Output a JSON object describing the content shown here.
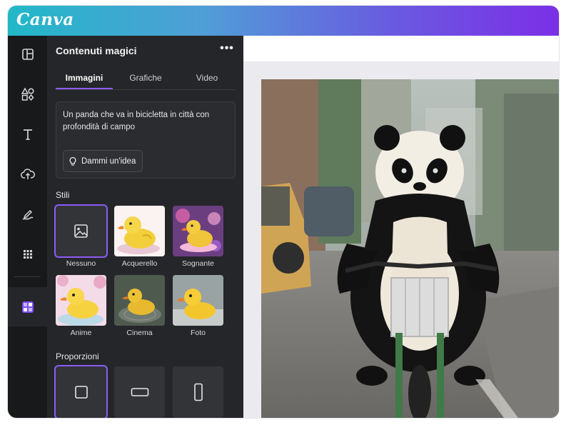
{
  "app": {
    "logo_text": "Canva"
  },
  "rail": {
    "items": [
      {
        "icon": "layout-icon"
      },
      {
        "icon": "elements-icon"
      },
      {
        "icon": "text-icon"
      },
      {
        "icon": "upload-icon"
      },
      {
        "icon": "draw-icon"
      },
      {
        "icon": "apps-grid-icon"
      },
      {
        "icon": "magic-media-icon",
        "active": true
      }
    ]
  },
  "panel": {
    "title": "Contenuti magici",
    "more_label": "•••",
    "tabs": [
      {
        "label": "Immagini",
        "active": true
      },
      {
        "label": "Grafiche"
      },
      {
        "label": "Video"
      }
    ],
    "prompt": {
      "value": "Un panda che va in bicicletta in città con profondità di campo",
      "idea_button": "Dammi un'idea"
    },
    "styles_label": "Stili",
    "styles": [
      {
        "name": "Nessuno",
        "selected": true
      },
      {
        "name": "Acquerello"
      },
      {
        "name": "Sognante"
      },
      {
        "name": "Anime"
      },
      {
        "name": "Cinema"
      },
      {
        "name": "Foto"
      }
    ],
    "ratios_label": "Proporzioni",
    "ratios": [
      {
        "shape": "square",
        "selected": true
      },
      {
        "shape": "landscape"
      },
      {
        "shape": "portrait"
      }
    ]
  },
  "colors": {
    "accent": "#8b5cf6",
    "panel_bg": "#252629",
    "rail_bg": "#18191b"
  }
}
